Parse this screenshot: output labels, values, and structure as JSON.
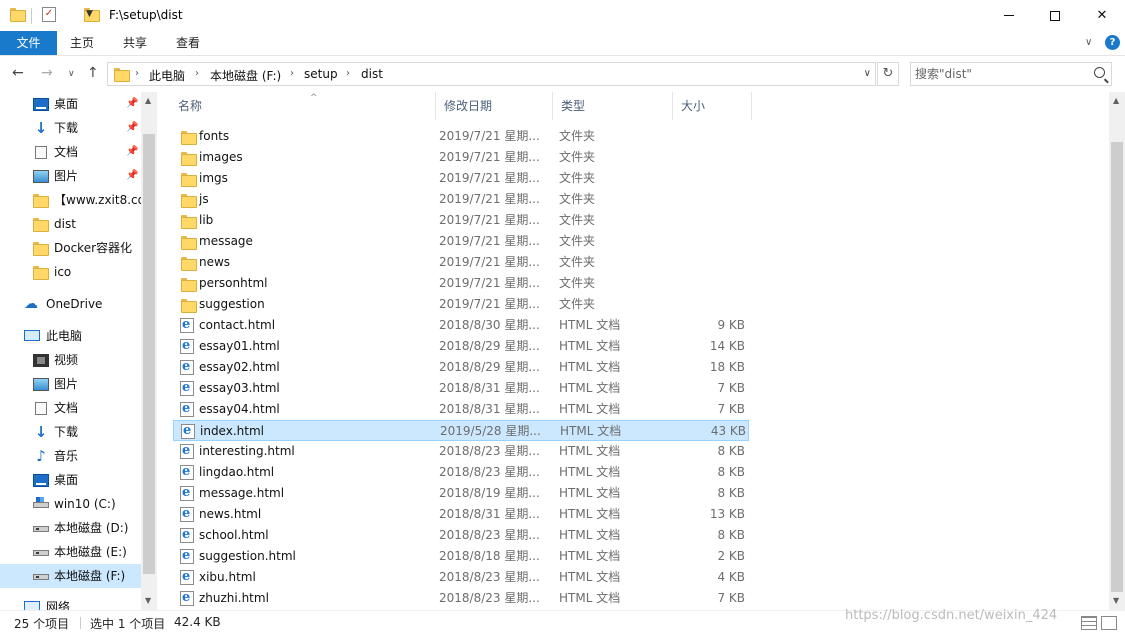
{
  "window": {
    "title": "F:\\setup\\dist"
  },
  "ribbon": {
    "tabs": [
      "文件",
      "主页",
      "共享",
      "查看"
    ]
  },
  "address": {
    "crumbs": [
      "此电脑",
      "本地磁盘 (F:)",
      "setup",
      "dist"
    ]
  },
  "search": {
    "placeholder": "搜索\"dist\""
  },
  "sidebar": {
    "items": [
      {
        "label": "桌面",
        "icon": "desktop-icon",
        "pinned": true
      },
      {
        "label": "下载",
        "icon": "download-icon",
        "pinned": true
      },
      {
        "label": "文档",
        "icon": "document-icon",
        "pinned": true
      },
      {
        "label": "图片",
        "icon": "pictures-icon",
        "pinned": true
      },
      {
        "label": "【www.zxit8.co",
        "icon": "folder-icon"
      },
      {
        "label": "dist",
        "icon": "folder-icon"
      },
      {
        "label": "Docker容器化",
        "icon": "folder-icon"
      },
      {
        "label": "ico",
        "icon": "folder-icon"
      },
      {
        "label": "OneDrive",
        "icon": "onedrive-icon"
      },
      {
        "label": "此电脑",
        "icon": "computer-icon"
      },
      {
        "label": "视频",
        "icon": "video-icon"
      },
      {
        "label": "图片",
        "icon": "pictures-icon"
      },
      {
        "label": "文档",
        "icon": "document-icon"
      },
      {
        "label": "下载",
        "icon": "download-icon"
      },
      {
        "label": "音乐",
        "icon": "music-icon"
      },
      {
        "label": "桌面",
        "icon": "desktop-icon"
      },
      {
        "label": "win10 (C:)",
        "icon": "system-drive-icon"
      },
      {
        "label": "本地磁盘 (D:)",
        "icon": "drive-icon"
      },
      {
        "label": "本地磁盘 (E:)",
        "icon": "drive-icon"
      },
      {
        "label": "本地磁盘 (F:)",
        "icon": "drive-icon",
        "selected": true
      },
      {
        "label": "网络",
        "icon": "network-icon"
      }
    ]
  },
  "columns": [
    "名称",
    "修改日期",
    "类型",
    "大小"
  ],
  "files": [
    {
      "name": "fonts",
      "date": "2019/7/21 星期...",
      "type": "文件夹",
      "size": "",
      "kind": "folder"
    },
    {
      "name": "images",
      "date": "2019/7/21 星期...",
      "type": "文件夹",
      "size": "",
      "kind": "folder"
    },
    {
      "name": "imgs",
      "date": "2019/7/21 星期...",
      "type": "文件夹",
      "size": "",
      "kind": "folder"
    },
    {
      "name": "js",
      "date": "2019/7/21 星期...",
      "type": "文件夹",
      "size": "",
      "kind": "folder"
    },
    {
      "name": "lib",
      "date": "2019/7/21 星期...",
      "type": "文件夹",
      "size": "",
      "kind": "folder"
    },
    {
      "name": "message",
      "date": "2019/7/21 星期...",
      "type": "文件夹",
      "size": "",
      "kind": "folder"
    },
    {
      "name": "news",
      "date": "2019/7/21 星期...",
      "type": "文件夹",
      "size": "",
      "kind": "folder"
    },
    {
      "name": "personhtml",
      "date": "2019/7/21 星期...",
      "type": "文件夹",
      "size": "",
      "kind": "folder"
    },
    {
      "name": "suggestion",
      "date": "2019/7/21 星期...",
      "type": "文件夹",
      "size": "",
      "kind": "folder"
    },
    {
      "name": "contact.html",
      "date": "2018/8/30 星期...",
      "type": "HTML 文档",
      "size": "9 KB",
      "kind": "html"
    },
    {
      "name": "essay01.html",
      "date": "2018/8/29 星期...",
      "type": "HTML 文档",
      "size": "14 KB",
      "kind": "html"
    },
    {
      "name": "essay02.html",
      "date": "2018/8/29 星期...",
      "type": "HTML 文档",
      "size": "18 KB",
      "kind": "html"
    },
    {
      "name": "essay03.html",
      "date": "2018/8/31 星期...",
      "type": "HTML 文档",
      "size": "7 KB",
      "kind": "html"
    },
    {
      "name": "essay04.html",
      "date": "2018/8/31 星期...",
      "type": "HTML 文档",
      "size": "7 KB",
      "kind": "html"
    },
    {
      "name": "index.html",
      "date": "2019/5/28 星期...",
      "type": "HTML 文档",
      "size": "43 KB",
      "kind": "html",
      "selected": true
    },
    {
      "name": "interesting.html",
      "date": "2018/8/23 星期...",
      "type": "HTML 文档",
      "size": "8 KB",
      "kind": "html"
    },
    {
      "name": "lingdao.html",
      "date": "2018/8/23 星期...",
      "type": "HTML 文档",
      "size": "8 KB",
      "kind": "html"
    },
    {
      "name": "message.html",
      "date": "2018/8/19 星期...",
      "type": "HTML 文档",
      "size": "8 KB",
      "kind": "html"
    },
    {
      "name": "news.html",
      "date": "2018/8/31 星期...",
      "type": "HTML 文档",
      "size": "13 KB",
      "kind": "html"
    },
    {
      "name": "school.html",
      "date": "2018/8/23 星期...",
      "type": "HTML 文档",
      "size": "8 KB",
      "kind": "html"
    },
    {
      "name": "suggestion.html",
      "date": "2018/8/18 星期...",
      "type": "HTML 文档",
      "size": "2 KB",
      "kind": "html"
    },
    {
      "name": "xibu.html",
      "date": "2018/8/23 星期...",
      "type": "HTML 文档",
      "size": "4 KB",
      "kind": "html"
    },
    {
      "name": "zhuzhi.html",
      "date": "2018/8/23 星期...",
      "type": "HTML 文档",
      "size": "7 KB",
      "kind": "html"
    }
  ],
  "status": {
    "count": "25 个项目",
    "selected": "选中 1 个项目",
    "size": "42.4 KB"
  },
  "watermark": "https://blog.csdn.net/weixin_424"
}
